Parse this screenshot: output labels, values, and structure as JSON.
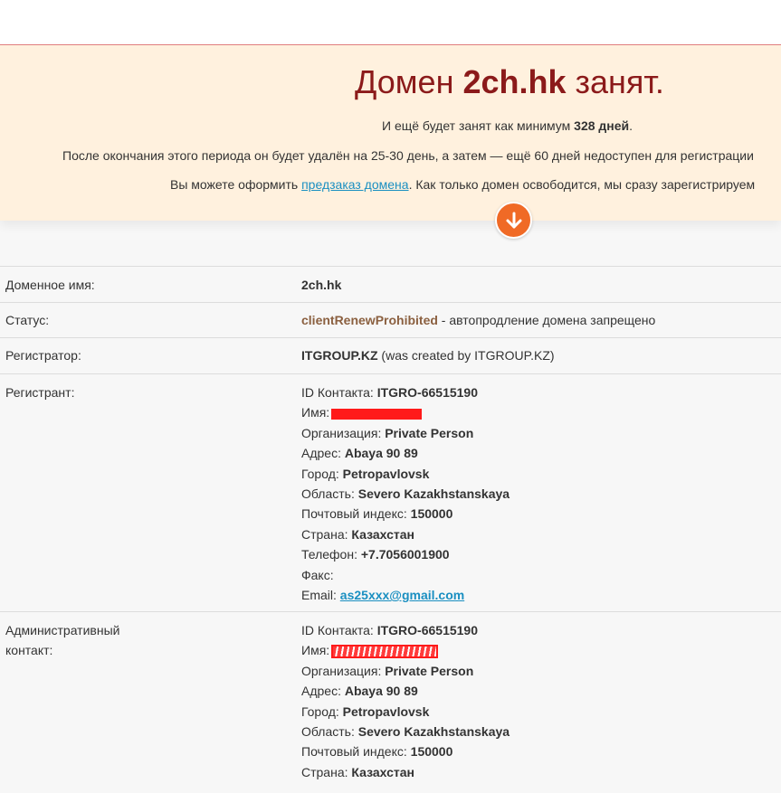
{
  "banner": {
    "title_prefix": "Домен ",
    "title_domain": "2ch.hk",
    "title_suffix": " занят.",
    "line1_prefix": "И ещё будет занят как минимум ",
    "line1_days": "328 дней",
    "line1_suffix": ".",
    "line2": "После окончания этого периода он будет удалён на 25-30 день, а затем — ещё 60 дней недоступен для регистрации",
    "line3_prefix": "Вы можете оформить ",
    "line3_link": "предзаказ домена",
    "line3_suffix": ". Как только домен освободится, мы сразу зарегистрируем"
  },
  "icons": {
    "down": "arrow-down-circle-icon",
    "accent": "#f06a26"
  },
  "rows": {
    "domain": {
      "label": "Доменное имя:",
      "value": "2ch.hk"
    },
    "status": {
      "label": "Статус:",
      "code": "clientRenewProhibited",
      "desc": " - автопродление домена запрещено"
    },
    "registrar": {
      "label": "Регистратор:",
      "name": "ITGROUP.KZ",
      "note": " (was created by ITGROUP.KZ)"
    },
    "registrant": {
      "label": "Регистрант:",
      "id_label": "ID Контакта: ",
      "id_value": "ITGRO-66515190",
      "name_label": "Имя:",
      "org_label": "Организация: ",
      "org_value": "Private Person",
      "address_label": "Адрес: ",
      "address_value": "Abaya 90 89",
      "city_label": "Город: ",
      "city_value": "Petropavlovsk",
      "region_label": "Область: ",
      "region_value": "Severo Kazakhstanskaya",
      "zip_label": "Почтовый индекс: ",
      "zip_value": "150000",
      "country_label": "Страна: ",
      "country_value": "Казахстан",
      "phone_label": "Телефон: ",
      "phone_value": "+7.7056001900",
      "fax_label": "Факс:",
      "email_label": "Email: ",
      "email_value": "as25xxx@gmail.com"
    },
    "admin": {
      "label": "Административный контакт:",
      "id_label": "ID Контакта: ",
      "id_value": "ITGRO-66515190",
      "name_label": "Имя:",
      "org_label": "Организация: ",
      "org_value": "Private Person",
      "address_label": "Адрес: ",
      "address_value": "Abaya 90 89",
      "city_label": "Город: ",
      "city_value": "Petropavlovsk",
      "region_label": "Область: ",
      "region_value": "Severo Kazakhstanskaya",
      "zip_label": "Почтовый индекс: ",
      "zip_value": "150000",
      "country_label": "Страна: ",
      "country_value": "Казахстан"
    }
  }
}
